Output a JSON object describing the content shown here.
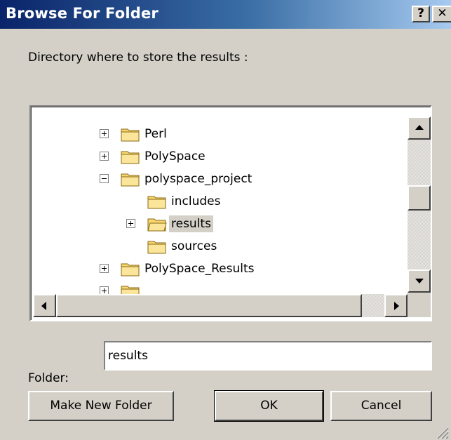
{
  "window": {
    "title": "Browse For Folder",
    "help_label": "?",
    "close_label": "✕"
  },
  "prompt": "Directory where to store the results :",
  "tree": {
    "items": [
      {
        "label": "Perl",
        "expander": "plus"
      },
      {
        "label": "PolySpace",
        "expander": "plus"
      },
      {
        "label": "polyspace_project",
        "expander": "minus"
      },
      {
        "label": "includes",
        "expander": "none"
      },
      {
        "label": "results",
        "expander": "plus",
        "selected": true
      },
      {
        "label": "sources",
        "expander": "none"
      },
      {
        "label": "PolySpace_Results",
        "expander": "plus"
      }
    ]
  },
  "folder_field": {
    "label": "Folder:",
    "value": "results"
  },
  "buttons": {
    "make_new_folder": "Make New Folder",
    "ok": "OK",
    "cancel": "Cancel"
  },
  "colors": {
    "title_start": "#0a246a",
    "title_end": "#a6caf0",
    "dialog_bg": "#d4d0c8",
    "folder_yellow": "#f7d774"
  }
}
